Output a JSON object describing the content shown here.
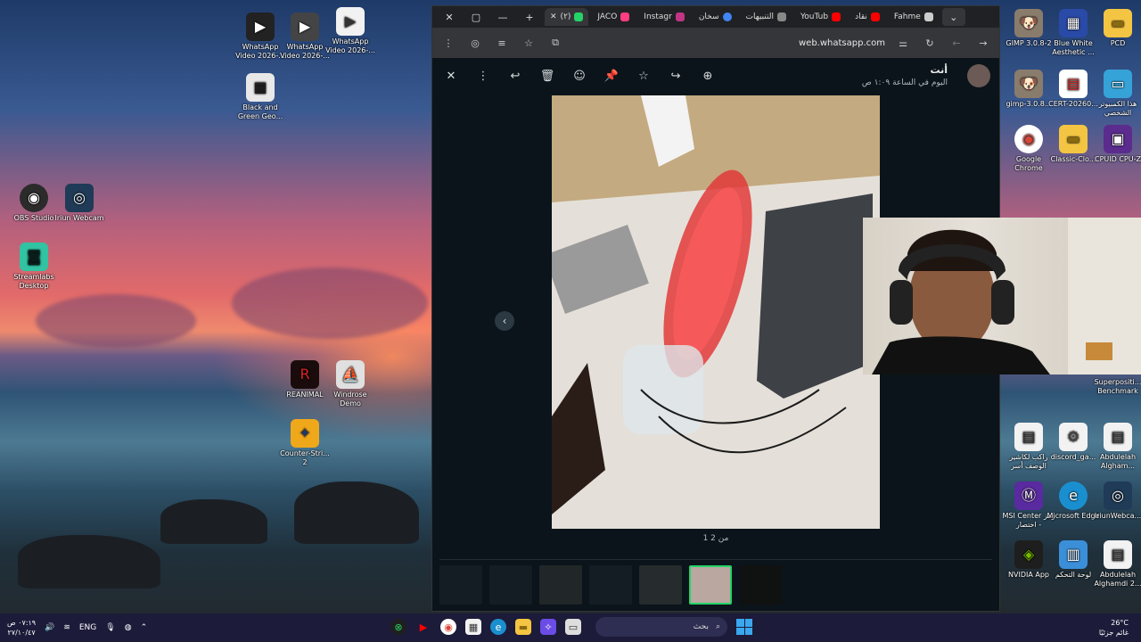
{
  "desktop": {
    "left_icons": [
      {
        "label": "WhatsApp Video 2026-...",
        "icon": "video-file-icon"
      },
      {
        "label": "WhatsApp Video 2026-...",
        "icon": "video-file-icon"
      },
      {
        "label": "WhatsApp Video 2026-...",
        "icon": "video-file-icon"
      },
      {
        "label": "Black and Green Geo...",
        "icon": "image-file-icon"
      },
      {
        "label": "OBS Studio",
        "icon": "obs-icon"
      },
      {
        "label": "Iriun Webcam",
        "icon": "webcam-icon"
      },
      {
        "label": "Streamlabs Desktop",
        "icon": "streamlabs-icon"
      },
      {
        "label": "REANIMAL",
        "icon": "game-icon"
      },
      {
        "label": "Windrose Demo",
        "icon": "game-icon"
      },
      {
        "label": "Counter-Stri... 2",
        "icon": "game-icon"
      }
    ],
    "right_icons": [
      {
        "label": "GIMP 3.0.8-2",
        "icon": "gimp-icon"
      },
      {
        "label": "Blue White Aesthetic ...",
        "icon": "image-file-icon"
      },
      {
        "label": "PCD",
        "icon": "folder-icon"
      },
      {
        "label": "gimp-3.0.8...",
        "icon": "gimp-icon"
      },
      {
        "label": "CERT-20260...",
        "icon": "document-icon"
      },
      {
        "label": "هذا الكمبيوتر الشخصي",
        "icon": "computer-icon"
      },
      {
        "label": "Google Chrome",
        "icon": "chrome-icon"
      },
      {
        "label": "Classic-Clo...",
        "icon": "folder-icon"
      },
      {
        "label": "CPUID CPU-Z",
        "icon": "cpuz-icon"
      },
      {
        "label": "Superpositi... Benchmark",
        "icon": "benchmark-icon"
      },
      {
        "label": "راكب لكاشير الوصف أسر",
        "icon": "document-icon"
      },
      {
        "label": "discord_ga...",
        "icon": "settings-file-icon"
      },
      {
        "label": "Abdulelah Algham...",
        "icon": "document-icon"
      },
      {
        "label": "MSI Center رمز اختصار -",
        "icon": "msi-icon"
      },
      {
        "label": "Microsoft Edge",
        "icon": "edge-icon"
      },
      {
        "label": "IriunWebca...",
        "icon": "webcam-icon"
      },
      {
        "label": "NVIDIA App",
        "icon": "nvidia-icon"
      },
      {
        "label": "لوحة التحكم",
        "icon": "control-panel-icon"
      },
      {
        "label": "Abdulelah Alghamdi 2...",
        "icon": "document-icon"
      }
    ]
  },
  "browser": {
    "tabs": [
      {
        "label": "(٢)",
        "badge": "2",
        "color": "#25d366"
      },
      {
        "label": "JACO",
        "color": "#ff3d7f"
      },
      {
        "label": "Instagr",
        "color": "#c13584"
      },
      {
        "label": "سخان",
        "color": "#4285f4"
      },
      {
        "label": "التنبيهات",
        "color": "#888888"
      },
      {
        "label": "YouTub",
        "color": "#ff0000"
      },
      {
        "label": "نقاد",
        "color": "#ff0000"
      },
      {
        "label": "Fahme",
        "color": "#cccccc"
      }
    ],
    "url": "web.whatsapp.com"
  },
  "viewer": {
    "sender_name": "أنت",
    "sender_time": "اليوم في الساعة ١:٠٩ ص",
    "counter": "1 من 2",
    "thumb_count": 7,
    "active_thumb": 6
  },
  "taskbar": {
    "time": "٠٧:١٩ ص",
    "date": "٢٧/١٠/٤٧",
    "lang": "ENG",
    "search_placeholder": "بحث",
    "weather_temp": "26°C",
    "weather_desc": "غائم جزئيًا"
  },
  "colors": {
    "whatsapp_green": "#25d366",
    "taskbar_bg": "#1c1b3a",
    "viewer_bg": "#0b141a"
  }
}
